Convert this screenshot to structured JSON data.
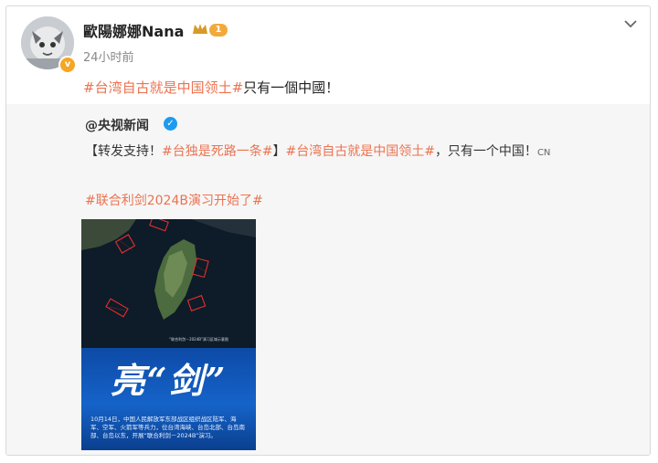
{
  "post": {
    "username": "歐陽娜娜Nana",
    "level": "1",
    "time": "24小时前",
    "text_tag": "#台湾自古就是中国领土#",
    "text_rest": "只有一個中國！"
  },
  "repost": {
    "author": "@央视新闻",
    "bracket_open": "【转发支持！",
    "tag1": "#台独是死路一条#",
    "bracket_close": "】",
    "tag2": "#台湾自古就是中国领土#",
    "text_tail": "，只有一个中国！",
    "cn_label": "CN",
    "tag3": "#联合利剑2024B演习开始了#"
  },
  "image": {
    "poster_title": "亮“剑”",
    "map_caption": "“联合利剑－2024B”演习区域示意图",
    "poster_text": "10月14日，中国人民解放军东部战区组织战区陆军、海军、空军、火箭军等兵力，位台湾海峡、台岛北部、台岛南部、台岛以东，开展“联合利剑－2024B”演习。"
  },
  "colors": {
    "tag": "#eb7350",
    "verified_blue": "#1d9bf0",
    "verified_gold": "#f5a623"
  }
}
